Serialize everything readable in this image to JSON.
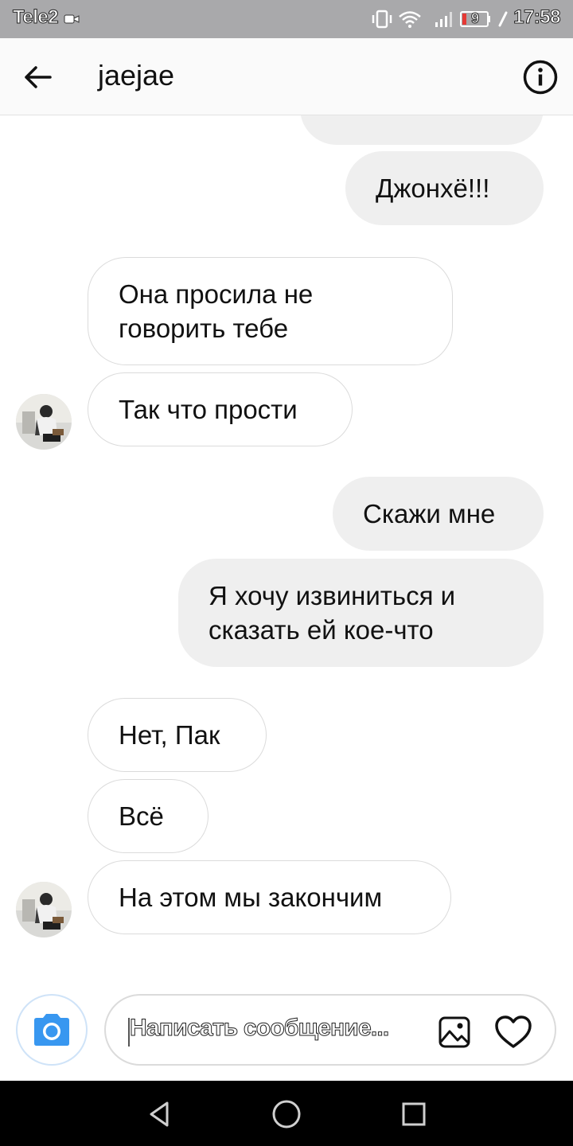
{
  "status_bar": {
    "carrier": "Tele2",
    "battery": "9",
    "time": "17:58"
  },
  "header": {
    "title": "jaejae"
  },
  "messages": [
    {
      "side": "out",
      "text": ""
    },
    {
      "side": "out",
      "text": "Джонхё!!!"
    },
    {
      "side": "in",
      "text": "Она просила не говорить тебе"
    },
    {
      "side": "in",
      "text": "Так что прости"
    },
    {
      "side": "out",
      "text": "Скажи мне"
    },
    {
      "side": "out",
      "text": "Я хочу извиниться и сказать ей кое-что"
    },
    {
      "side": "in",
      "text": "Нет, Пак"
    },
    {
      "side": "in",
      "text": "Всё"
    },
    {
      "side": "in",
      "text": "На этом мы закончим"
    }
  ],
  "composer": {
    "placeholder": "Написать сообщение..."
  },
  "colors": {
    "outgoing_bubble": "#efefef",
    "incoming_border": "#dbdbdb",
    "camera_blue": "#3897f0",
    "status_bar": "#a9a9ab"
  },
  "icons": [
    "back-arrow-icon",
    "info-icon",
    "camera-icon",
    "gallery-icon",
    "heart-icon",
    "nav-back-icon",
    "nav-home-icon",
    "nav-recents-icon"
  ]
}
